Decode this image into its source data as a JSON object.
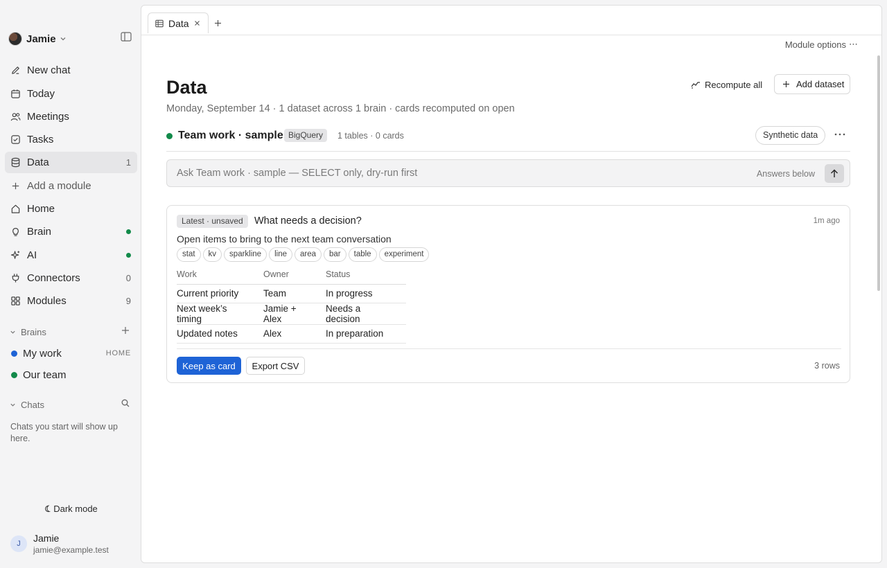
{
  "colors": {
    "accent": "#1e63d6",
    "status_green": "#128a4a",
    "brain_blue": "#1e63d6"
  },
  "workspace": {
    "name": "Jamie"
  },
  "sidebar": {
    "items": [
      {
        "label": "New chat",
        "icon": "pencil-icon"
      },
      {
        "label": "Today",
        "icon": "calendar-icon"
      },
      {
        "label": "Meetings",
        "icon": "people-icon"
      },
      {
        "label": "Tasks",
        "icon": "checkbox-icon"
      },
      {
        "label": "Data",
        "icon": "database-icon",
        "count": "1",
        "active": true
      },
      {
        "label": "Add a module",
        "icon": "plus-icon"
      },
      {
        "label": "Home",
        "icon": "home-icon"
      },
      {
        "label": "Brain",
        "icon": "lightbulb-icon",
        "status": "green-dot"
      },
      {
        "label": "AI",
        "icon": "sparkle-icon",
        "status": "green-dot"
      },
      {
        "label": "Connectors",
        "icon": "plug-icon",
        "count": "0"
      },
      {
        "label": "Modules",
        "icon": "grid-icon",
        "count": "9"
      }
    ],
    "brains_heading": "Brains",
    "brains": [
      {
        "label": "My work",
        "tag": "HOME",
        "color": "#1e63d6"
      },
      {
        "label": "Our team",
        "color": "#128a4a"
      }
    ],
    "chats_heading": "Chats",
    "chats_empty": "Chats you start will show up here.",
    "dark_mode_label": "Dark mode",
    "user": {
      "initial": "J",
      "name": "Jamie",
      "email": "jamie@example.test"
    }
  },
  "tabs": [
    {
      "label": "Data",
      "icon": "table-icon"
    }
  ],
  "module_options_label": "Module options",
  "page": {
    "title": "Data",
    "subtitle": "Monday, September 14 · 1 dataset across 1 brain · cards recomputed on open",
    "recompute_label": "Recompute all",
    "add_dataset_label": "Add dataset"
  },
  "dataset": {
    "name": "Team work · sample",
    "source_badge": "BigQuery",
    "meta": "1 tables · 0 cards",
    "synthetic_label": "Synthetic data"
  },
  "ask": {
    "placeholder": "Ask Team work · sample — SELECT only, dry-run first",
    "hint": "Answers below"
  },
  "card": {
    "badge": "Latest · unsaved",
    "title": "What needs a decision?",
    "time": "1m ago",
    "description": "Open items to bring to the next team conversation",
    "chips": [
      "stat",
      "kv",
      "sparkline",
      "line",
      "area",
      "bar",
      "table",
      "experiment"
    ],
    "table": {
      "columns": [
        "Work",
        "Owner",
        "Status"
      ],
      "rows": [
        [
          "Current priority",
          "Team",
          "In progress"
        ],
        [
          "Next week’s timing",
          "Jamie + Alex",
          "Needs a decision"
        ],
        [
          "Updated notes",
          "Alex",
          "In preparation"
        ]
      ]
    },
    "keep_label": "Keep as card",
    "export_label": "Export CSV",
    "row_count": "3 rows"
  }
}
